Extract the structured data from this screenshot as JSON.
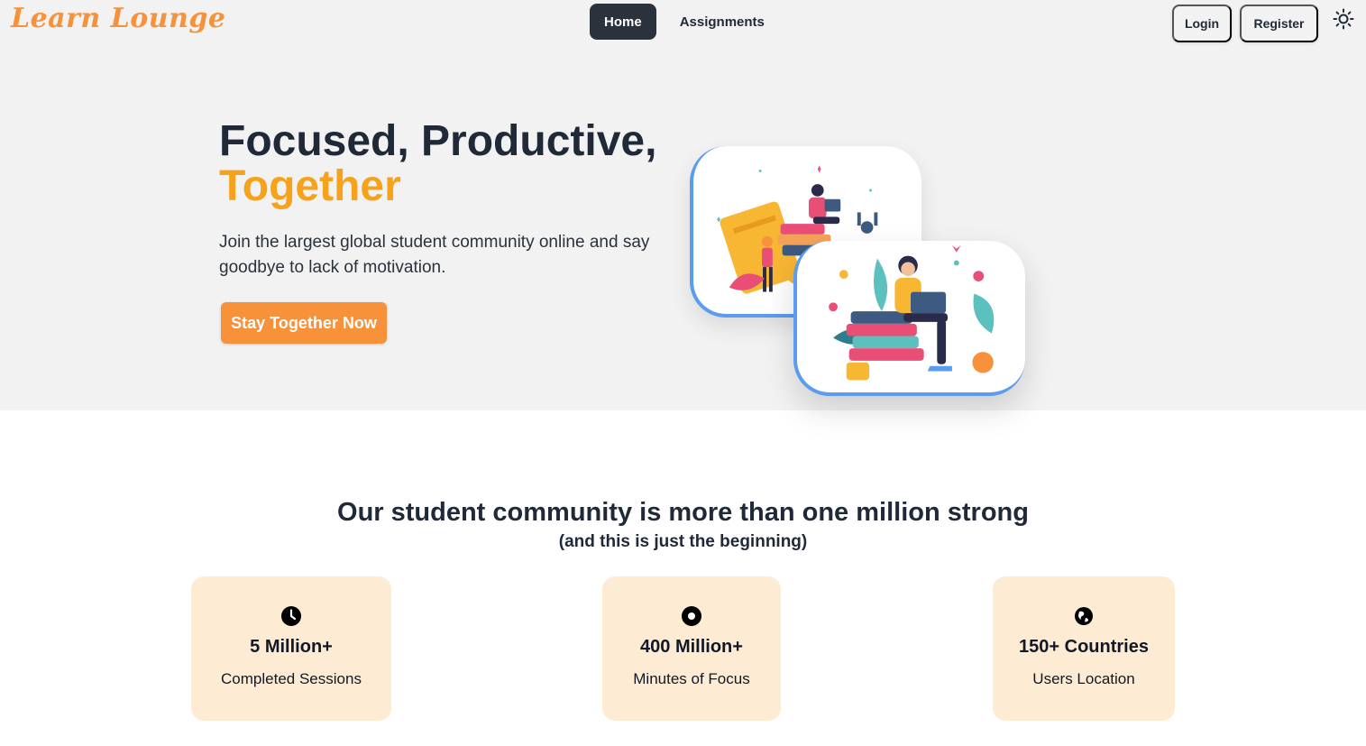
{
  "navbar": {
    "logo": "Learn Lounge",
    "links": [
      {
        "label": "Home",
        "active": true
      },
      {
        "label": "Assignments",
        "active": false
      }
    ],
    "login_label": "Login",
    "register_label": "Register",
    "theme_icon": "sun-icon"
  },
  "hero": {
    "title_line1": "Focused, Productive,",
    "title_line2": "Together",
    "subtitle": "Join the largest global student community online and say goodbye to lack of motivation.",
    "cta_label": "Stay Together Now"
  },
  "community": {
    "title": "Our student community is more than one million strong",
    "subtitle": "(and this is just the beginning)",
    "stats": [
      {
        "icon": "clock-icon",
        "value": "5 Million+",
        "label": "Completed Sessions"
      },
      {
        "icon": "target-icon",
        "value": "400 Million+",
        "label": "Minutes of Focus"
      },
      {
        "icon": "globe-icon",
        "value": "150+ Countries",
        "label": "Users Location"
      }
    ]
  },
  "colors": {
    "brand_orange": "#f7913a",
    "accent_yellow": "#f7a21b",
    "nav_active": "#2a323c",
    "stat_card_bg": "#feebd4",
    "hero_bg": "#f2f2f2"
  }
}
